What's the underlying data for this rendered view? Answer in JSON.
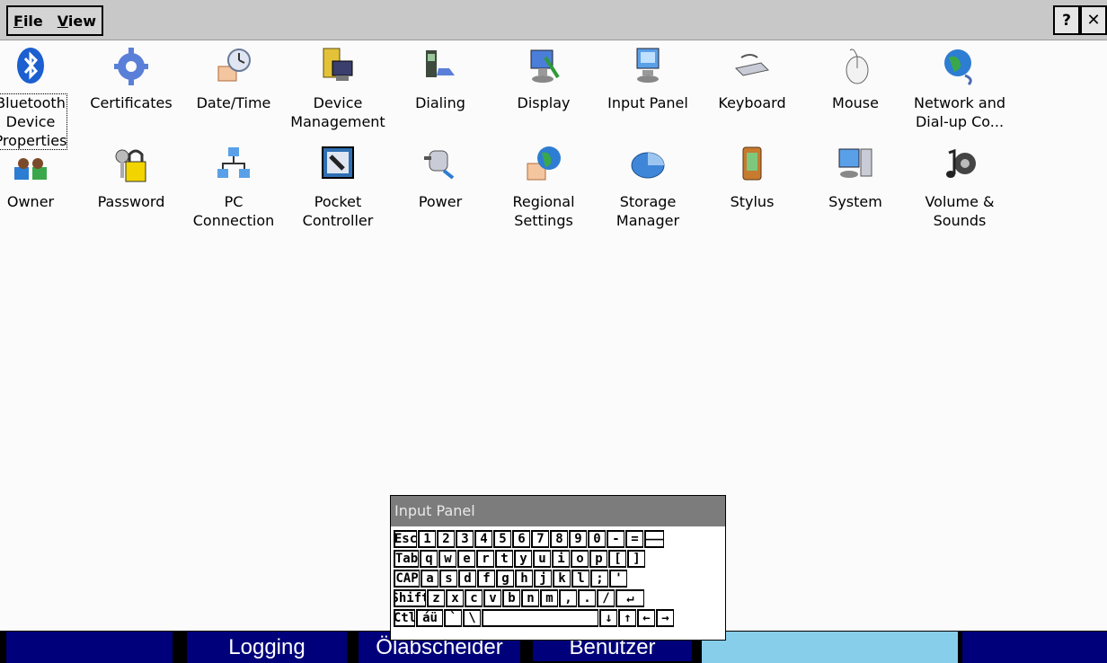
{
  "menu": {
    "file": "File",
    "view": "View",
    "help_btn": "?",
    "close_btn": "✕"
  },
  "items": [
    {
      "label": "Bluetooth\nDevice\nProperties",
      "icon": "bluetooth-icon"
    },
    {
      "label": "Certificates",
      "icon": "certificates-icon"
    },
    {
      "label": "Date/Time",
      "icon": "datetime-icon"
    },
    {
      "label": "Device\nManagement",
      "icon": "device-management-icon"
    },
    {
      "label": "Dialing",
      "icon": "dialing-icon"
    },
    {
      "label": "Display",
      "icon": "display-icon"
    },
    {
      "label": "Input Panel",
      "icon": "input-panel-icon"
    },
    {
      "label": "Keyboard",
      "icon": "keyboard-icon"
    },
    {
      "label": "Mouse",
      "icon": "mouse-icon"
    },
    {
      "label": "Network and\nDial-up Co...",
      "icon": "network-icon"
    },
    {
      "label": "Owner",
      "icon": "owner-icon"
    },
    {
      "label": "Password",
      "icon": "password-icon"
    },
    {
      "label": "PC\nConnection",
      "icon": "pc-connection-icon"
    },
    {
      "label": "Pocket\nController",
      "icon": "pocket-controller-icon"
    },
    {
      "label": "Power",
      "icon": "power-icon"
    },
    {
      "label": "Regional\nSettings",
      "icon": "regional-settings-icon"
    },
    {
      "label": "Storage\nManager",
      "icon": "storage-manager-icon"
    },
    {
      "label": "Stylus",
      "icon": "stylus-icon"
    },
    {
      "label": "System",
      "icon": "system-icon"
    },
    {
      "label": "Volume &\nSounds",
      "icon": "volume-icon"
    }
  ],
  "input_panel": {
    "title": "Input Panel",
    "rows": [
      [
        "Esc",
        "1",
        "2",
        "3",
        "4",
        "5",
        "6",
        "7",
        "8",
        "9",
        "0",
        "-",
        "=",
        "🡐"
      ],
      [
        "Tab",
        "q",
        "w",
        "e",
        "r",
        "t",
        "y",
        "u",
        "i",
        "o",
        "p",
        "[",
        "]"
      ],
      [
        "CAP",
        "a",
        "s",
        "d",
        "f",
        "g",
        "h",
        "j",
        "k",
        "l",
        ";",
        "'"
      ],
      [
        "Shift",
        "z",
        "x",
        "c",
        "v",
        "b",
        "n",
        "m",
        ",",
        ".",
        "/",
        "↵"
      ],
      [
        "Ctl",
        "áü",
        "`",
        "\\",
        " ",
        "↓",
        "↑",
        "←",
        "→"
      ]
    ]
  },
  "taskbar": {
    "tab1": "Logging",
    "tab2": "Ölabscheider",
    "tab3": "Benutzer"
  },
  "colors": {
    "taskbar_dark": "#00007a",
    "taskbar_light": "#87ceeb",
    "menubar": "#c8c8c8"
  }
}
